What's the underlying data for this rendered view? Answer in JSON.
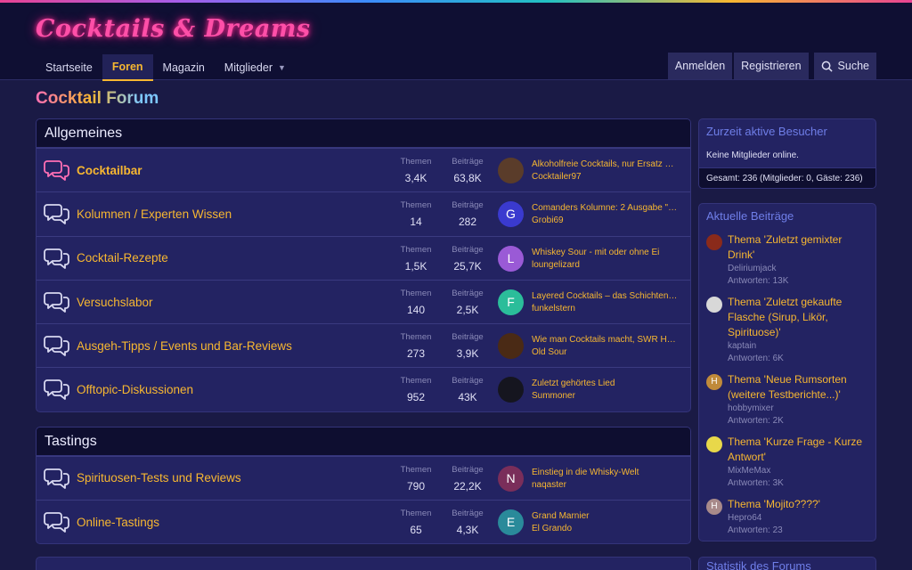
{
  "site": {
    "logo": "Cocktails & Dreams"
  },
  "nav": {
    "items": [
      {
        "label": "Startseite"
      },
      {
        "label": "Foren"
      },
      {
        "label": "Magazin"
      },
      {
        "label": "Mitglieder"
      }
    ],
    "login": "Anmelden",
    "register": "Registrieren",
    "search": "Suche"
  },
  "page": {
    "title": "Cocktail Forum"
  },
  "labels": {
    "themen": "Themen",
    "beitraege": "Beiträge"
  },
  "blocks": [
    {
      "title": "Allgemeines",
      "nodes": [
        {
          "title": "Cocktailbar",
          "themen": "3,4K",
          "beitraege": "63,8K",
          "last_title": "Alkoholfreie Cocktails, nur Ersatz …",
          "last_user": "Cocktailer97",
          "avatar": "",
          "avatar_color": "#5a3c2a"
        },
        {
          "title": "Kolumnen / Experten Wissen",
          "themen": "14",
          "beitraege": "282",
          "last_title": "Comanders Kolumne: 2 Ausgabe \"…",
          "last_user": "Grobi69",
          "avatar": "G",
          "avatar_color": "#3a3acf"
        },
        {
          "title": "Cocktail-Rezepte",
          "themen": "1,5K",
          "beitraege": "25,7K",
          "last_title": "Whiskey Sour - mit oder ohne Ei",
          "last_user": "loungelizard",
          "avatar": "L",
          "avatar_color": "#9a5ad6"
        },
        {
          "title": "Versuchslabor",
          "themen": "140",
          "beitraege": "2,5K",
          "last_title": "Layered Cocktails – das Schichten…",
          "last_user": "funkelstern",
          "avatar": "F",
          "avatar_color": "#2bbd9a"
        },
        {
          "title": "Ausgeh-Tipps / Events und Bar-Reviews",
          "themen": "273",
          "beitraege": "3,9K",
          "last_title": "Wie man Cocktails macht, SWR H…",
          "last_user": "Old Sour",
          "avatar": "",
          "avatar_color": "#4a2a15"
        },
        {
          "title": "Offtopic-Diskussionen",
          "themen": "952",
          "beitraege": "43K",
          "last_title": "Zuletzt gehörtes Lied",
          "last_user": "Summoner",
          "avatar": "",
          "avatar_color": "#15151f"
        }
      ]
    },
    {
      "title": "Tastings",
      "nodes": [
        {
          "title": "Spirituosen-Tests und Reviews",
          "themen": "790",
          "beitraege": "22,2K",
          "last_title": "Einstieg in die Whisky-Welt",
          "last_user": "naqaster",
          "avatar": "N",
          "avatar_color": "#7a2e5a"
        },
        {
          "title": "Online-Tastings",
          "themen": "65",
          "beitraege": "4,3K",
          "last_title": "Grand Marnier",
          "last_user": "El Grando",
          "avatar": "E",
          "avatar_color": "#2a8a9a"
        }
      ]
    }
  ],
  "sidebar": {
    "visitors": {
      "title": "Zurzeit aktive Besucher",
      "text": "Keine Mitglieder online.",
      "footer": "Gesamt: 236 (Mitglieder: 0, Gäste: 236)"
    },
    "recent": {
      "title": "Aktuelle Beiträge",
      "posts": [
        {
          "title": "Thema 'Zuletzt gemixter Drink'",
          "user": "Deliriumjack",
          "meta": "Antworten: 13K",
          "avatar": "",
          "avatar_color": "#8a2a1a"
        },
        {
          "title": "Thema 'Zuletzt gekaufte Flasche (Sirup, Likör, Spirituose)'",
          "user": "kaptain",
          "meta": "Antworten: 6K",
          "avatar": "",
          "avatar_color": "#d8d8d8"
        },
        {
          "title": "Thema 'Neue Rumsorten (weitere Testberichte...)'",
          "user": "hobbymixer",
          "meta": "Antworten: 2K",
          "avatar": "H",
          "avatar_color": "#c08a3a"
        },
        {
          "title": "Thema 'Kurze Frage - Kurze Antwort'",
          "user": "MixMeMax",
          "meta": "Antworten: 3K",
          "avatar": "",
          "avatar_color": "#e8d84a"
        },
        {
          "title": "Thema 'Mojito????'",
          "user": "Hepro64",
          "meta": "Antworten: 23",
          "avatar": "H",
          "avatar_color": "#a88a8a"
        }
      ]
    },
    "stats": {
      "title": "Statistik des Forums"
    }
  },
  "colors": {
    "accent": "#f7b731",
    "brand_pink": "#ff4fa8",
    "sidebar_head": "#6f7ee8",
    "background": "#1a1a45"
  },
  "icons": {
    "node": "comments-icon",
    "search": "search-icon",
    "dropdown": "chevron-down-icon"
  }
}
